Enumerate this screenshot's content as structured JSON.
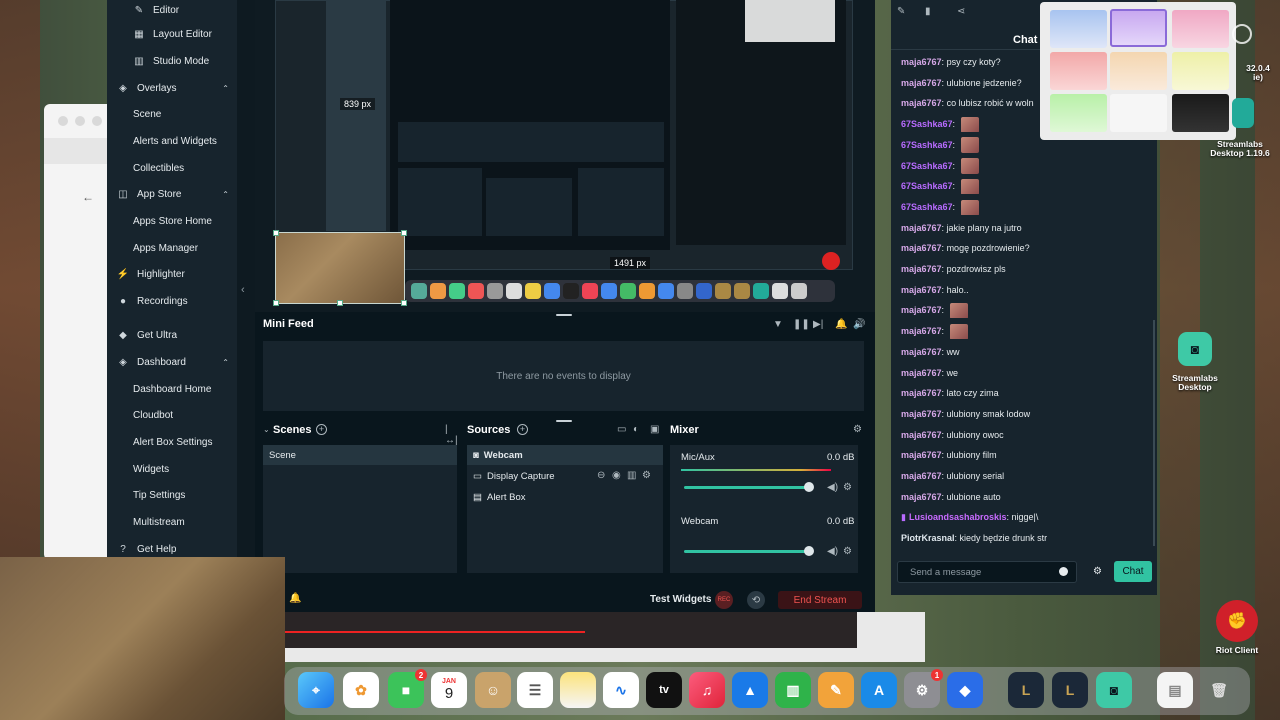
{
  "sidebar": {
    "items": [
      {
        "label": "Editor",
        "icon": "pencil-icon",
        "kind": "sub"
      },
      {
        "label": "Layout Editor",
        "icon": "grid-icon",
        "kind": "sub"
      },
      {
        "label": "Studio Mode",
        "icon": "columns-icon",
        "kind": "sub"
      },
      {
        "label": "Overlays",
        "icon": "layers-icon",
        "kind": "main",
        "expanded": true
      },
      {
        "label": "Scene",
        "kind": "sub"
      },
      {
        "label": "Alerts and Widgets",
        "kind": "sub"
      },
      {
        "label": "Collectibles",
        "kind": "sub"
      },
      {
        "label": "App Store",
        "icon": "store-icon",
        "kind": "main",
        "expanded": true
      },
      {
        "label": "Apps Store Home",
        "kind": "sub"
      },
      {
        "label": "Apps Manager",
        "kind": "sub"
      },
      {
        "label": "Highlighter",
        "icon": "lightning-icon",
        "kind": "main"
      },
      {
        "label": "Recordings",
        "icon": "record-icon",
        "kind": "main"
      },
      {
        "label": "Get Ultra",
        "icon": "ultra-icon",
        "kind": "main"
      },
      {
        "label": "Dashboard",
        "icon": "dashboard-icon",
        "kind": "main",
        "expanded": true
      },
      {
        "label": "Dashboard Home",
        "kind": "sub"
      },
      {
        "label": "Cloudbot",
        "kind": "sub"
      },
      {
        "label": "Alert Box Settings",
        "kind": "sub"
      },
      {
        "label": "Widgets",
        "kind": "sub"
      },
      {
        "label": "Tip Settings",
        "kind": "sub"
      },
      {
        "label": "Multistream",
        "kind": "sub"
      },
      {
        "label": "Get Help",
        "icon": "help-icon",
        "kind": "main"
      }
    ]
  },
  "preview": {
    "width_label": "839 px",
    "height_label": "1491 px"
  },
  "mini_feed": {
    "title": "Mini Feed",
    "empty_text": "There are no events to display"
  },
  "scenes": {
    "title": "Scenes",
    "items": [
      "Scene"
    ]
  },
  "sources": {
    "title": "Sources",
    "items": [
      {
        "label": "Webcam",
        "icon": "camera-icon"
      },
      {
        "label": "Display Capture",
        "icon": "monitor-icon"
      },
      {
        "label": "Alert Box",
        "icon": "alert-icon"
      }
    ]
  },
  "mixer": {
    "title": "Mixer",
    "channels": [
      {
        "name": "Mic/Aux",
        "level": "0.0 dB",
        "volume": 0.99
      },
      {
        "name": "Webcam",
        "level": "0.0 dB",
        "volume": 0.99
      }
    ]
  },
  "bottom_bar": {
    "test_widgets": "Test Widgets",
    "rec_label": "REC",
    "end_stream": "End Stream"
  },
  "chat": {
    "title": "Chat",
    "messages": [
      {
        "user": "maja6767",
        "text": "psy czy koty?",
        "color": "#d6a8e8"
      },
      {
        "user": "maja6767",
        "text": "ulubione jedzenie?",
        "color": "#d6a8e8"
      },
      {
        "user": "maja6767",
        "text": "co lubisz robić w woln",
        "color": "#d6a8e8"
      },
      {
        "user": "67Sashka67",
        "text": "",
        "emote": true,
        "color": "#b86bff"
      },
      {
        "user": "67Sashka67",
        "text": "",
        "emote": true,
        "color": "#b86bff"
      },
      {
        "user": "67Sashka67",
        "text": "",
        "emote": true,
        "color": "#b86bff"
      },
      {
        "user": "67Sashka67",
        "text": "",
        "emote": true,
        "color": "#b86bff"
      },
      {
        "user": "67Sashka67",
        "text": "",
        "emote": true,
        "color": "#b86bff"
      },
      {
        "user": "maja6767",
        "text": "jakie plany na jutro",
        "color": "#d6a8e8"
      },
      {
        "user": "maja6767",
        "text": "mogę pozdrowienie?",
        "color": "#d6a8e8"
      },
      {
        "user": "maja6767",
        "text": "pozdrowisz pls",
        "color": "#d6a8e8"
      },
      {
        "user": "maja6767",
        "text": "halo..",
        "color": "#d6a8e8"
      },
      {
        "user": "maja6767",
        "text": "",
        "emote": true,
        "color": "#d6a8e8"
      },
      {
        "user": "maja6767",
        "text": "",
        "emote": true,
        "color": "#d6a8e8"
      },
      {
        "user": "maja6767",
        "text": "ww",
        "color": "#d6a8e8"
      },
      {
        "user": "maja6767",
        "text": "we",
        "color": "#d6a8e8"
      },
      {
        "user": "maja6767",
        "text": "lato czy zima",
        "color": "#d6a8e8"
      },
      {
        "user": "maja6767",
        "text": "ulubiony smak lodow",
        "color": "#d6a8e8"
      },
      {
        "user": "maja6767",
        "text": "ulubiony owoc",
        "color": "#d6a8e8"
      },
      {
        "user": "maja6767",
        "text": "ulubiony film",
        "color": "#d6a8e8"
      },
      {
        "user": "maja6767",
        "text": "ulubiony serial",
        "color": "#d6a8e8"
      },
      {
        "user": "maja6767",
        "text": "ulubione auto",
        "color": "#d6a8e8"
      },
      {
        "user": "Lusioandsashabroskis",
        "text": "nigge|\\",
        "color": "#c86bff",
        "badge": true
      },
      {
        "user": "PiotrKrasnal",
        "text": "kiedy będzie drunk stream",
        "color": "#e0e8ee"
      }
    ],
    "input_placeholder": "Send a message",
    "send_label": "Chat"
  },
  "desktop": {
    "top_right_label": "32.0.4",
    "top_right_label2": "ie)",
    "app1": "Streamlabs Desktop 1.19.6",
    "app2": "Streamlabs Desktop",
    "app3": "Riot Client"
  },
  "dock": {
    "calendar_month": "JAN",
    "calendar_day": "9",
    "facetime_badge": "2",
    "settings_badge": "1",
    "appletv_label": "tv"
  },
  "colors": {
    "accent": "#31c3a2",
    "danger": "#ef5350",
    "sidebar_bg": "#17242d",
    "panel_bg": "#09161d"
  }
}
